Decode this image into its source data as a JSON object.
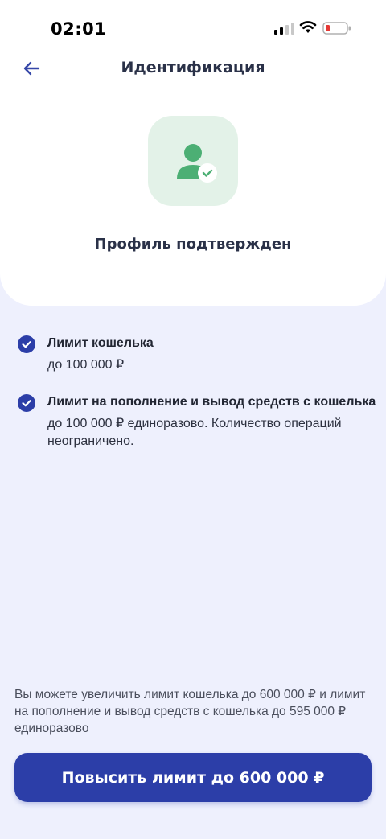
{
  "status_bar": {
    "time": "02:01"
  },
  "header": {
    "title": "Идентификация",
    "back_icon": "arrow-left-icon"
  },
  "profile": {
    "status_title": "Профиль подтвержден",
    "icon": "user-verified-icon"
  },
  "limits": [
    {
      "title": "Лимит кошелька",
      "description": "до 100 000 ₽"
    },
    {
      "title": "Лимит на пополнение и вывод средств с кошелька",
      "description": "до 100 000 ₽ единоразово. Количество операций неограничено."
    }
  ],
  "info": {
    "text": "Вы можете увеличить лимит кошелька до 600 000 ₽ и лимит на пополнение и вывод средств с кошелька до 595 000 ₽ единоразово"
  },
  "action": {
    "button_label": "Повысить лимит до 600 000 ₽"
  },
  "colors": {
    "primary": "#2c3ea8",
    "success": "#4caf74",
    "background": "#eef0fd"
  }
}
